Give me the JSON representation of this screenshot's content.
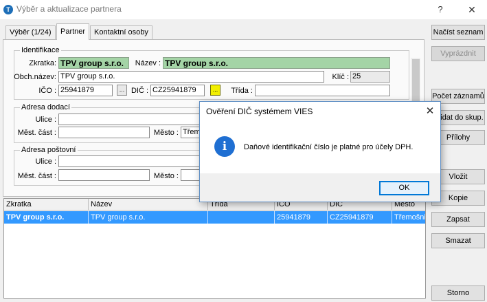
{
  "window": {
    "title": "Výběr a aktualizace partnera",
    "help": "?",
    "close": "✕",
    "icon_letter": "T"
  },
  "tabs": [
    "Výběr (1/24)",
    "Partner",
    "Kontaktní osoby"
  ],
  "active_tab": "Partner",
  "identifikace": {
    "legend": "Identifikace",
    "zkratka_label": "Zkratka:",
    "zkratka_value": "TPV group s.r.o.",
    "nazev_label": "Název :",
    "nazev_value": "TPV group s.r.o.",
    "obch_label": "Obch.název:",
    "obch_value": "TPV group s.r.o.",
    "klic_label": "Klíč :",
    "klic_value": "25",
    "ico_label": "IČO :",
    "ico_value": "25941879",
    "dic_label": "DIČ :",
    "dic_value": "CZ25941879",
    "trida_label": "Třída :",
    "trida_value": "",
    "dots": "..."
  },
  "adresa_dodaci": {
    "legend": "Adresa dodací",
    "ulice_label": "Ulice :",
    "mest_label": "Měst. část :",
    "mesto_label": "Město :",
    "mesto_value": "Třem"
  },
  "adresa_postovni": {
    "legend": "Adresa poštovní",
    "ulice_label": "Ulice :",
    "mest_label": "Měst. část :",
    "mesto_label": "Město :"
  },
  "buttons": {
    "nacist": "Načíst seznam",
    "vyprazdnit": "Vyprázdnit",
    "pocet": "Počet záznamů",
    "pridat": "Přidat do skup.",
    "prilohy": "Přílohy",
    "vlozit": "Vložit",
    "kopie": "Kopie",
    "zapsat": "Zapsat",
    "smazat": "Smazat",
    "storno": "Storno"
  },
  "grid": {
    "columns": [
      "Zkratka",
      "Název",
      "Třída",
      "IČO",
      "DIČ",
      "Město"
    ],
    "rows": [
      [
        "TPV group s.r.o.",
        "TPV group s.r.o.",
        "",
        "25941879",
        "CZ25941879",
        "Třemošnice"
      ]
    ]
  },
  "dialog": {
    "title": "Ověření DIČ systémem VIES",
    "close": "✕",
    "icon": "i",
    "message": "Daňové identifikační číslo je platné pro účely DPH.",
    "ok": "OK"
  }
}
